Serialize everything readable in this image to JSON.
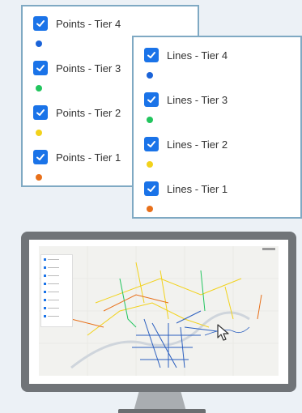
{
  "points_panel": {
    "items": [
      {
        "label": "Points - Tier 4",
        "dot_color": "#1a63d8",
        "checked": true
      },
      {
        "label": "Points - Tier 3",
        "dot_color": "#22c55e",
        "checked": true
      },
      {
        "label": "Points - Tier 2",
        "dot_color": "#f2d21b",
        "checked": true
      },
      {
        "label": "Points - Tier 1",
        "dot_color": "#e8701a",
        "checked": true
      }
    ]
  },
  "lines_panel": {
    "items": [
      {
        "label": "Lines - Tier 4",
        "dot_color": "#1a63d8",
        "checked": true
      },
      {
        "label": "Lines - Tier 3",
        "dot_color": "#22c55e",
        "checked": true
      },
      {
        "label": "Lines - Tier 2",
        "dot_color": "#f2d21b",
        "checked": true
      },
      {
        "label": "Lines - Tier 1",
        "dot_color": "#e8701a",
        "checked": true
      }
    ]
  },
  "colors": {
    "checkbox": "#1a73e8",
    "panel_border": "#7fa9c3",
    "monitor_bezel": "#707478"
  },
  "icons": {
    "checkbox": "checkmark-icon",
    "cursor": "mouse-pointer-icon"
  }
}
